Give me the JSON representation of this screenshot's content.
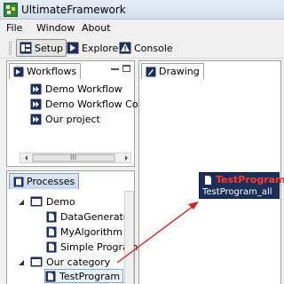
{
  "window": {
    "title": "UltimateFramework"
  },
  "menu": {
    "items": [
      "File",
      "Window",
      "About"
    ]
  },
  "toolbar": {
    "setup_label": "Setup",
    "explore_label": "Explore",
    "console_label": "Console"
  },
  "workflows": {
    "tab_label": "Workflows",
    "items": [
      "Demo Workflow",
      "Demo Workflow Con",
      "Our project"
    ],
    "scroll_grip": "III"
  },
  "drawing": {
    "tab_label": "Drawing"
  },
  "processes": {
    "tab_label": "Processes",
    "tree": {
      "folder1": "Demo",
      "folder1_items": [
        "DataGenerator",
        "MyAlgorithm",
        "Simple Program"
      ],
      "folder2": "Our category",
      "folder2_items": [
        "TestProgram"
      ]
    }
  },
  "node": {
    "name": "TestProgram",
    "subtitle": "TestProgram_all"
  },
  "colors": {
    "accent": "#1c2f5a",
    "connector": "#e02020",
    "node_name": "#ff3b2f"
  }
}
